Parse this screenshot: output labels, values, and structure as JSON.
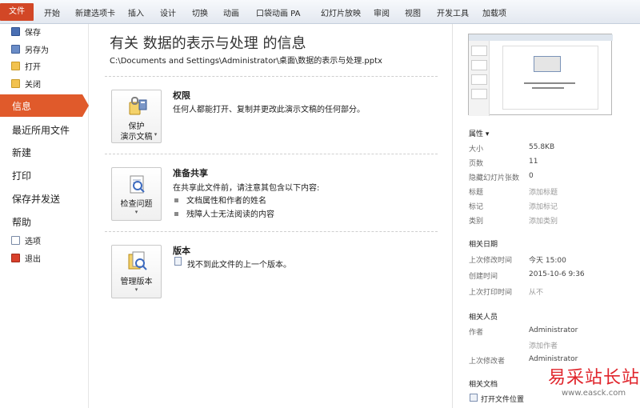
{
  "ribbon": {
    "tabs": [
      "文件",
      "开始",
      "新建选项卡",
      "插入",
      "设计",
      "切换",
      "动画",
      "口袋动画 PA",
      "幻灯片放映",
      "审阅",
      "视图",
      "开发工具",
      "加载项"
    ]
  },
  "nav": {
    "save": "保存",
    "save_as": "另存为",
    "open": "打开",
    "close": "关闭",
    "info": "信息",
    "recent": "最近所用文件",
    "new": "新建",
    "print": "打印",
    "save_send": "保存并发送",
    "help": "帮助",
    "options": "选项",
    "exit": "退出"
  },
  "main": {
    "title": "有关 数据的表示与处理 的信息",
    "path": "C:\\Documents and Settings\\Administrator\\桌面\\数据的表示与处理.pptx",
    "permissions": {
      "button_line1": "保护",
      "button_line2": "演示文稿",
      "heading": "权限",
      "text": "任何人都能打开、复制并更改此演示文稿的任何部分。"
    },
    "prepare": {
      "button_label": "检查问题",
      "heading": "准备共享",
      "text": "在共享此文件前，请注意其包含以下内容:",
      "bullets": [
        "文档属性和作者的姓名",
        "残障人士无法阅读的内容"
      ]
    },
    "versions": {
      "button_label": "管理版本",
      "heading": "版本",
      "text": "找不到此文件的上一个版本。"
    }
  },
  "properties": {
    "heading": "属性 ▾",
    "size_label": "大小",
    "size_value": "55.8KB",
    "pages_label": "页数",
    "pages_value": "11",
    "hidden_label": "隐藏幻灯片张数",
    "hidden_value": "0",
    "title_label": "标题",
    "title_placeholder": "添加标题",
    "tags_label": "标记",
    "tags_placeholder": "添加标记",
    "category_label": "类别",
    "category_placeholder": "添加类别"
  },
  "dates": {
    "heading": "相关日期",
    "modified_label": "上次修改时间",
    "modified_value": "今天 15:00",
    "created_label": "创建时间",
    "created_value": "2015-10-6 9:36",
    "printed_label": "上次打印时间",
    "printed_value": "从不"
  },
  "people": {
    "heading": "相关人员",
    "author_label": "作者",
    "author_value": "Administrator",
    "add_author": "添加作者",
    "modifier_label": "上次修改者",
    "modifier_value": "Administrator"
  },
  "documents": {
    "heading": "相关文档",
    "open_location": "打开文件位置"
  },
  "watermark": {
    "title": "易采站长站",
    "url": "www.easck.com"
  },
  "colors": {
    "accent": "#e05a2b",
    "file_tab": "#d24726",
    "watermark": "#e0242b"
  }
}
